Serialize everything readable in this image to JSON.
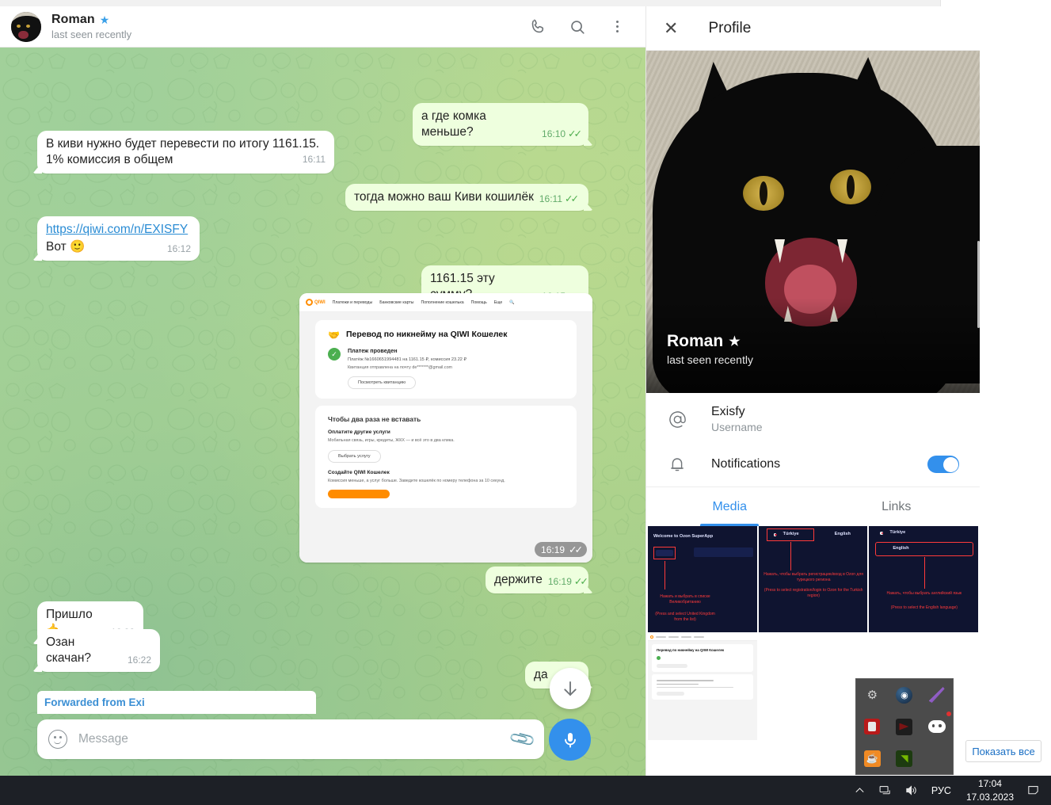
{
  "chat": {
    "header": {
      "name": "Roman",
      "premium_badge": "★",
      "status": "last seen recently",
      "icons": {
        "call": "phone-icon",
        "search": "search-icon",
        "menu": "more-menu-icon"
      }
    },
    "messages": [
      {
        "id": "m1",
        "dir": "out",
        "text": "а где комка меньше?",
        "time": "16:10",
        "ticks": "✓✓"
      },
      {
        "id": "m2",
        "dir": "in",
        "text": "В киви нужно будет перевести по итогу 1161.15. 1% комиссия в общем",
        "time": "16:11"
      },
      {
        "id": "m3",
        "dir": "out",
        "text": "тогда можно ваш Киви кошилёк",
        "time": "16:11",
        "ticks": "✓✓"
      },
      {
        "id": "m4",
        "dir": "in",
        "link": "https://qiwi.com/n/EXISFY",
        "text": "Вот 🙂",
        "time": "16:12"
      },
      {
        "id": "m5",
        "dir": "out",
        "text": "1161.15 эту сумму?",
        "time": "16:15",
        "ticks": "✓✓"
      },
      {
        "id": "m6",
        "dir": "photo",
        "time": "16:19",
        "ticks": "✓✓"
      },
      {
        "id": "m7",
        "dir": "out",
        "text": "держите",
        "time": "16:19",
        "ticks": "✓✓"
      },
      {
        "id": "m8",
        "dir": "in",
        "text": "Пришло 🤙",
        "time": "16:22"
      },
      {
        "id": "m9",
        "dir": "in",
        "text": "Озан скачан?",
        "time": "16:22"
      },
      {
        "id": "m10",
        "dir": "out",
        "text": "да",
        "time": "",
        "ticks": ""
      }
    ],
    "photo_message": {
      "nav_logo": "QIWI",
      "nav_logo_sub": "Кошелек",
      "nav_links": [
        "Платежи и переводы",
        "Банковские карты",
        "Пополнение кошелька",
        "Помощь",
        "Еще"
      ],
      "nav_search_icon": "search-icon",
      "card1_title": "Перевод по никнейму на QIWI Кошелек",
      "card1_emoji": "🤝",
      "status_title": "Платеж проведен",
      "status_line": "Платёж №16606519944⁠81 на 1161.15 ₽, комиссия 23.22 ₽",
      "receipt_line": "Квитанция отправлена на почту de*******@gmail.com",
      "receipt_button": "Посмотреть квитанцию",
      "card2_title": "Чтобы два раза не вставать",
      "card2_sub1": "Оплатите другие услуги",
      "card2_p1": "Мобильная связь, игры, кредиты, ЖКХ — и всё это в два клика.",
      "card2_btn1": "Выбрать услугу",
      "card2_sub2": "Создайте QIWI Кошелек",
      "card2_p2": "Комиссия меньше, а услуг больше. Заведите кошелёк по номеру телефона за 10 секунд."
    },
    "forwarded_bar": {
      "label": "Forwarded from Exi"
    },
    "composer": {
      "emoji_icon": "smiley-icon",
      "placeholder": "Message",
      "value": "",
      "attach_icon": "paperclip-icon",
      "record_icon": "microphone-icon"
    },
    "scroll_down_icon": "arrow-down-icon"
  },
  "profile": {
    "header": {
      "close_icon": "close-icon",
      "title": "Profile"
    },
    "name": "Roman",
    "premium_badge": "★",
    "status": "last seen recently",
    "rows": [
      {
        "icon": "at-icon",
        "value": "Exisfy",
        "label": "Username"
      },
      {
        "icon": "bell-icon",
        "value": "Notifications",
        "toggle": true
      }
    ],
    "tabs": [
      {
        "label": "Media",
        "active": true
      },
      {
        "label": "Links",
        "active": false
      }
    ],
    "media": [
      {
        "id": "t1",
        "kind": "ozon",
        "title": "Welcome to Ozon SuperApp",
        "note_ru": "Нажать и выбрать в списке Великобританию",
        "note_en": "(Press and select United Kingdom from the list)"
      },
      {
        "id": "t2",
        "kind": "flags2",
        "flag1": "TR",
        "flag1_label": "Türkiye",
        "flag2": "UK",
        "flag2_label": "English",
        "note_ru": "Нажать, чтобы выбрать регистрацию/вход в Ozon для турецкого региона",
        "note_en": "(Press to select registration/login to Ozon for the Turkish region)"
      },
      {
        "id": "t3",
        "kind": "flags1",
        "flag1": "TR",
        "flag1_label": "Türkiye",
        "flag2": "UK",
        "flag2_label": "English",
        "note_ru": "Нажать, чтобы выбрать английский язык",
        "note_en": "(Press to select the English language)"
      },
      {
        "id": "t4",
        "kind": "qiwi",
        "title": "Перевод по никнейму на QIWI Кошелек"
      }
    ]
  },
  "desktop": {
    "show_all_button": "Показать все",
    "tray_popup_icons": [
      "gear-icon",
      "steam-icon",
      "feather-icon",
      "red-app-icon",
      "dark-arrow-icon",
      "discord-icon",
      "java-icon",
      "nvidia-icon"
    ],
    "taskbar": {
      "chevron_icon": "chevron-up-icon",
      "network_icon": "network-icon",
      "volume_icon": "volume-icon",
      "language": "РУС",
      "time": "17:04",
      "date": "17.03.2023",
      "notification_icon": "notification-icon"
    }
  }
}
